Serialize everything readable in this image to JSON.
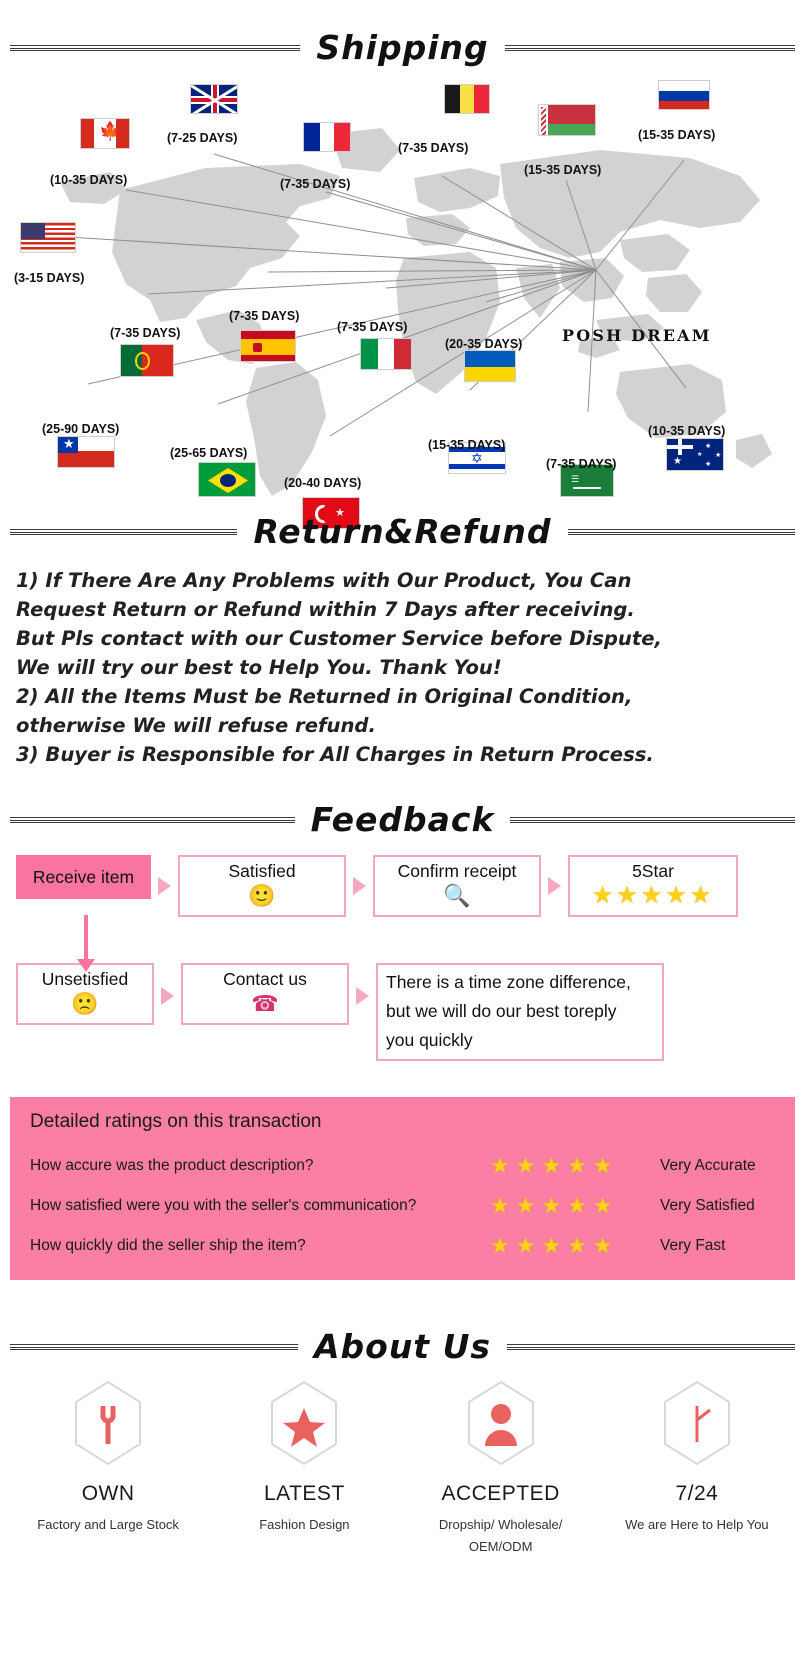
{
  "sections": {
    "shipping_title": "Shipping",
    "return_title": "Return&Refund",
    "feedback_title": "Feedback",
    "about_title": "About Us"
  },
  "shipping": {
    "hub_label": "POSH DREAM",
    "destinations": [
      {
        "country": "United Kingdom",
        "flag": "uk",
        "days": "(7-25 DAYS)"
      },
      {
        "country": "Canada",
        "flag": "canada",
        "days": "(10-35 DAYS)"
      },
      {
        "country": "France",
        "flag": "france",
        "days": "(7-35 DAYS)"
      },
      {
        "country": "Belgium",
        "flag": "belgium",
        "days": "(7-35 DAYS)"
      },
      {
        "country": "Belarus",
        "flag": "belarus",
        "days": "(15-35 DAYS)"
      },
      {
        "country": "Russia",
        "flag": "russia",
        "days": "(15-35 DAYS)"
      },
      {
        "country": "United States",
        "flag": "usa",
        "days": "(3-15 DAYS)"
      },
      {
        "country": "Portugal",
        "flag": "portugal",
        "days": "(7-35 DAYS)"
      },
      {
        "country": "Spain",
        "flag": "spain",
        "days": "(7-35 DAYS)"
      },
      {
        "country": "Italy",
        "flag": "italy",
        "days": "(7-35 DAYS)"
      },
      {
        "country": "Ukraine",
        "flag": "ukraine",
        "days": "(20-35 DAYS)"
      },
      {
        "country": "Chile",
        "flag": "chile",
        "days": "(25-90 DAYS)"
      },
      {
        "country": "Brazil",
        "flag": "brazil",
        "days": "(25-65 DAYS)"
      },
      {
        "country": "Turkey",
        "flag": "turkey",
        "days": "(20-40 DAYS)"
      },
      {
        "country": "Israel",
        "flag": "israel",
        "days": "(15-35 DAYS)"
      },
      {
        "country": "Saudi Arabia",
        "flag": "saudi",
        "days": "(7-35 DAYS)"
      },
      {
        "country": "Australia",
        "flag": "australia",
        "days": "(10-35 DAYS)"
      }
    ]
  },
  "return_refund": {
    "lines": [
      "1) If There Are Any Problems with Our Product, You Can",
      "Request Return or Refund within 7 Days after receiving.",
      "But Pls contact with our Customer Service before Dispute,",
      "We will try our best to Help You. Thank You!",
      "2) All the Items Must be Returned in Original Condition,",
      "otherwise We will refuse refund.",
      "3) Buyer is Responsible for All Charges in Return Process."
    ]
  },
  "feedback": {
    "receive_item": "Receive item",
    "satisfied": "Satisfied",
    "satisfied_emoji": "🙂",
    "confirm_receipt": "Confirm receipt",
    "confirm_emoji": "🔍",
    "five_star": "5Star",
    "five_star_glyphs": "★★★★★",
    "unsatisfied": "Unsetisfied",
    "unsatisfied_emoji": "🙁",
    "contact_us": "Contact us",
    "contact_emoji": "☎",
    "note_lines": [
      "There is a time zone difference,",
      "but we will do our best toreply",
      "you quickly"
    ]
  },
  "ratings": {
    "title": "Detailed ratings on this transaction",
    "rows": [
      {
        "question": "How accure was the product description?",
        "stars": "★★★★★",
        "label": "Very Accurate"
      },
      {
        "question": "How satisfied were you with the seller's communication?",
        "stars": "★★★★★",
        "label": "Very Satisfied"
      },
      {
        "question": "How quickly did the seller ship the item?",
        "stars": "★★★★★",
        "label": "Very Fast"
      }
    ],
    "background_color": "#fb7fa5"
  },
  "about": {
    "items": [
      {
        "icon": "wrench-icon",
        "title": "OWN",
        "sub": "Factory and Large Stock"
      },
      {
        "icon": "star-icon",
        "title": "LATEST",
        "sub": "Fashion  Design"
      },
      {
        "icon": "person-icon",
        "title": "ACCEPTED",
        "sub": "Dropship/ Wholesale/ OEM/ODM"
      },
      {
        "icon": "clock-icon",
        "title": "7/24",
        "sub": "We are Here to Help You"
      }
    ]
  },
  "colors": {
    "pink": "#fb7fa5",
    "pink_border": "#f2a7bf",
    "star_yellow": "#fcd116",
    "map_gray": "#cfcfcf",
    "icon_red": "#e8635f"
  }
}
